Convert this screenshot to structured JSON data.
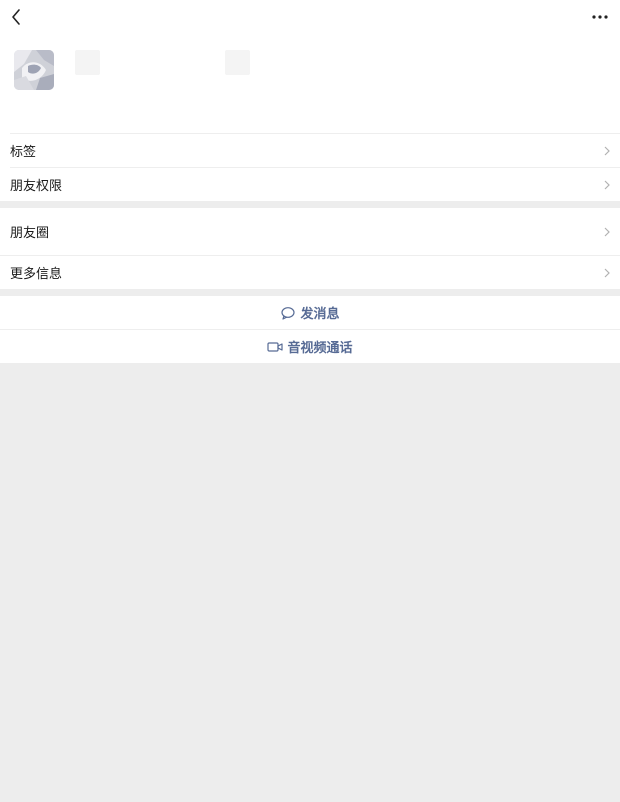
{
  "header": {
    "back_icon": "chevron-left-icon",
    "more_icon": "more-horizontal-icon"
  },
  "profile": {
    "avatar": "avatar-image"
  },
  "menu": {
    "group1": [
      {
        "label": "标签"
      },
      {
        "label": "朋友权限"
      }
    ],
    "group2": [
      {
        "label": "朋友圈"
      },
      {
        "label": "更多信息"
      }
    ]
  },
  "actions": {
    "message_label": "发消息",
    "call_label": "音视频通话"
  },
  "colors": {
    "link": "#576b95",
    "background": "#ededed",
    "row": "#ffffff"
  }
}
